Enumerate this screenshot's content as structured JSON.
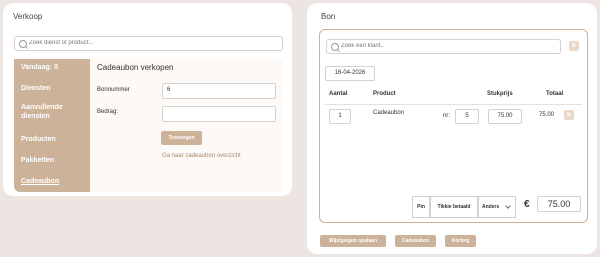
{
  "verkoop": {
    "title": "Verkoop",
    "search_placeholder": "Zoek dienst of product...",
    "sidebar": [
      {
        "label": "Vandaag: 0"
      },
      {
        "label": "Diensten"
      },
      {
        "label": "Aanvullende diensten"
      },
      {
        "label": "Producten"
      },
      {
        "label": "Pakketten"
      },
      {
        "label": "Cadeaubon"
      }
    ],
    "content": {
      "title": "Cadeaubon verkopen",
      "bonnummer_label": "Bonnummer",
      "bonnummer_value": "6",
      "bedrag_label": "Bedrag:",
      "bedrag_value": "",
      "add_button": "Toevoegen",
      "overview_link": "Ga naar cadeaubon overzicht"
    }
  },
  "bon": {
    "title": "Bon",
    "client_search_placeholder": "Zoek een klant..",
    "date": "16-04-2026",
    "columns": {
      "aantal": "Aantal",
      "product": "Product",
      "stukprijs": "Stukprijs",
      "totaal": "Totaal"
    },
    "rows": [
      {
        "aantal": "1",
        "product": "Cadeaubon",
        "nr_label": "nr:",
        "nr": "5",
        "stukprijs": "75.00",
        "totaal": "75.00",
        "remove": "×"
      }
    ],
    "clear_client": "×",
    "payment": {
      "pin": "Pin",
      "tikkie": "Tikkie betaald",
      "anders": "Anders",
      "anders_icon": "chevron-down-icon"
    },
    "currency": "€",
    "total": "75.00",
    "actions": {
      "save": "Wijzigingen opslaan",
      "cadeaubon": "Cadeaubon",
      "korting": "Korting"
    }
  },
  "colors": {
    "accent": "#cdb29a",
    "background": "#ece5e1",
    "content_bg": "#fdf9f6"
  }
}
